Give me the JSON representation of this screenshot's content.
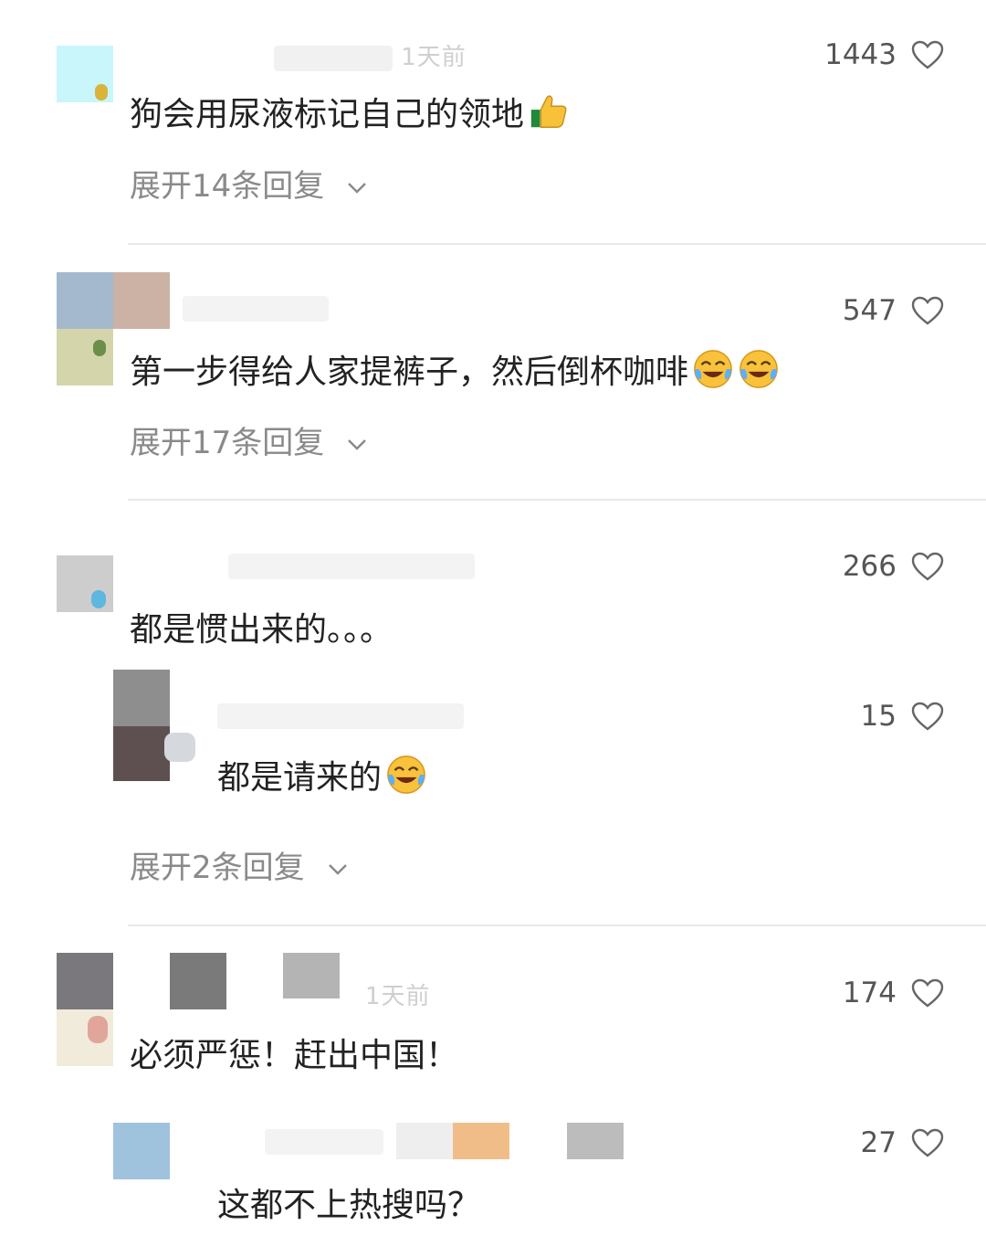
{
  "comments": [
    {
      "text": "狗会用尿液标记自己的领地",
      "emoji": "thumbs-up",
      "likes": "1443",
      "expand": "展开14条回复",
      "meta": "1天前"
    },
    {
      "text": "第一步得给人家提裤子，然后倒杯咖啡",
      "emoji": "laugh-cry",
      "likes": "547",
      "expand": "展开17条回复",
      "meta": ""
    },
    {
      "text": "都是惯出来的。。。",
      "likes": "266",
      "expand": "",
      "meta": ""
    },
    {
      "text": "都是请来的",
      "emoji": "laugh-cry",
      "likes": "15",
      "expand": "展开2条回复",
      "meta": ""
    },
    {
      "text": "必须严惩！赶出中国！",
      "likes": "174",
      "meta": "1天前"
    },
    {
      "text": "这都不上热搜吗？",
      "likes": "27",
      "meta": ""
    }
  ],
  "colors": {
    "text": "#222222",
    "muted": "#8a8a8a",
    "count": "#555555",
    "divider": "#e9e9e9"
  },
  "icons": {
    "like": "heart-outline-icon",
    "expand": "chevron-down-icon"
  }
}
